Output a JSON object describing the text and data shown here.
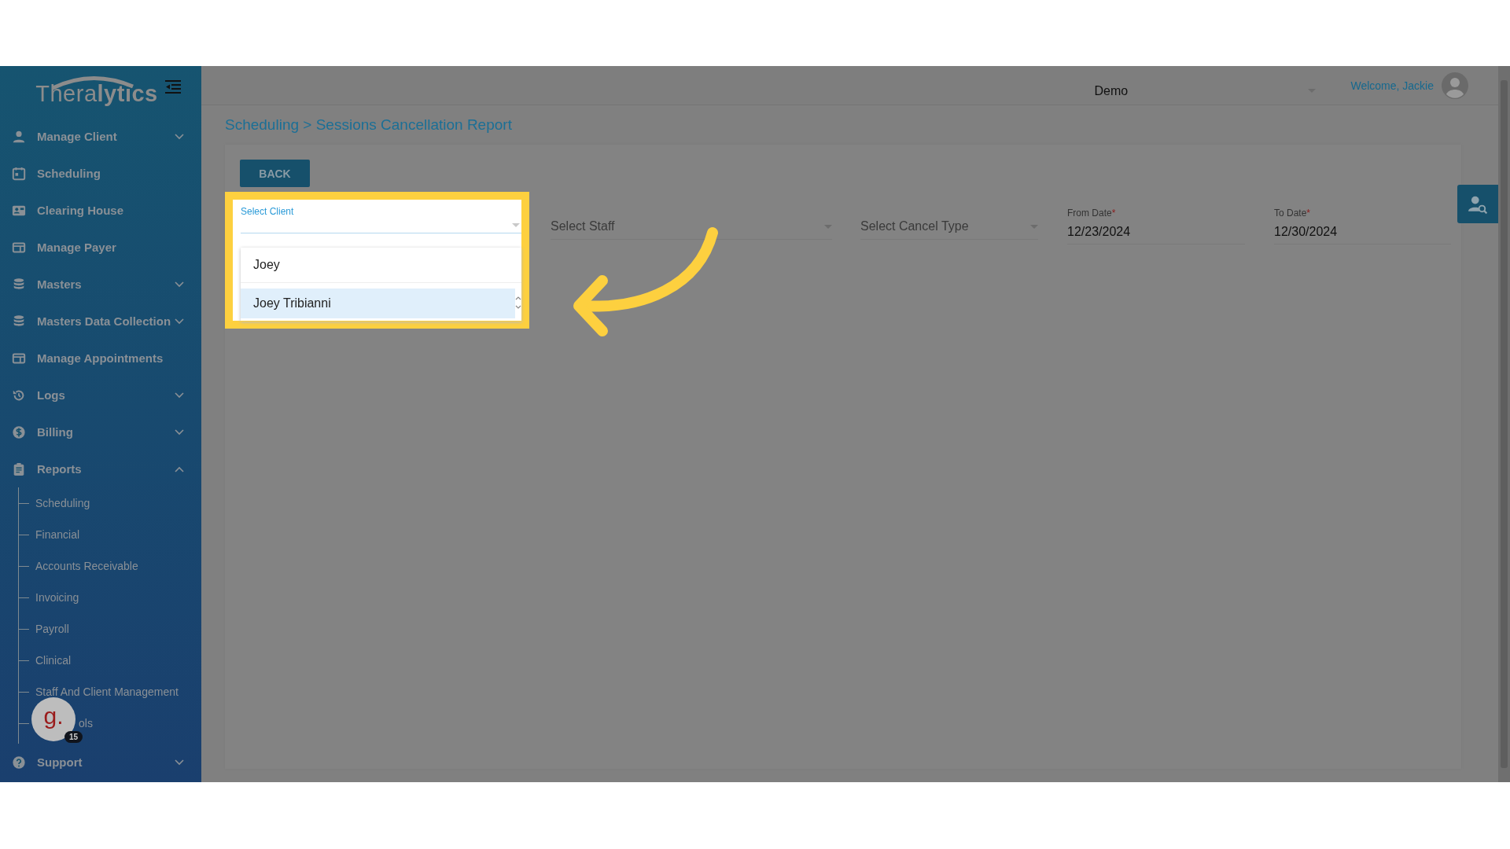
{
  "sidebar": {
    "logo": {
      "light": "Thera",
      "bold": "lytics"
    },
    "items": [
      {
        "label": "Manage Client",
        "expandable": true,
        "expanded": false
      },
      {
        "label": "Scheduling",
        "expandable": false
      },
      {
        "label": "Clearing House",
        "expandable": false
      },
      {
        "label": "Manage Payer",
        "expandable": false
      },
      {
        "label": "Masters",
        "expandable": true,
        "expanded": false
      },
      {
        "label": "Masters Data Collection",
        "expandable": true,
        "expanded": false
      },
      {
        "label": "Manage Appointments",
        "expandable": false
      },
      {
        "label": "Logs",
        "expandable": true,
        "expanded": false
      },
      {
        "label": "Billing",
        "expandable": true,
        "expanded": false
      },
      {
        "label": "Reports",
        "expandable": true,
        "expanded": true,
        "children": [
          {
            "label": "Scheduling"
          },
          {
            "label": "Financial"
          },
          {
            "label": "Accounts Receivable"
          },
          {
            "label": "Invoicing"
          },
          {
            "label": "Payroll"
          },
          {
            "label": "Clinical"
          },
          {
            "label": "Staff And Client Management"
          },
          {
            "label": "ols"
          }
        ]
      },
      {
        "label": "Support",
        "expandable": true,
        "expanded": false
      }
    ]
  },
  "header": {
    "organization": "Demo",
    "welcome": "Welcome, Jackie"
  },
  "breadcrumb": "Scheduling > Sessions Cancellation Report",
  "back_button": "BACK",
  "filters": {
    "client": {
      "label": "Select Client",
      "options": [
        {
          "label": "Joey",
          "selected": false
        },
        {
          "label": "Joey Tribianni",
          "selected": true
        }
      ]
    },
    "staff": {
      "placeholder": "Select Staff"
    },
    "cancel_type": {
      "placeholder": "Select Cancel Type"
    },
    "dates": [
      {
        "label": "From Date",
        "required_mark": "*",
        "value": "12/23/2024"
      },
      {
        "label": "To Date",
        "required_mark": "*",
        "value": "12/30/2024"
      }
    ]
  },
  "assistant": {
    "letter": "g.",
    "count": "15"
  }
}
